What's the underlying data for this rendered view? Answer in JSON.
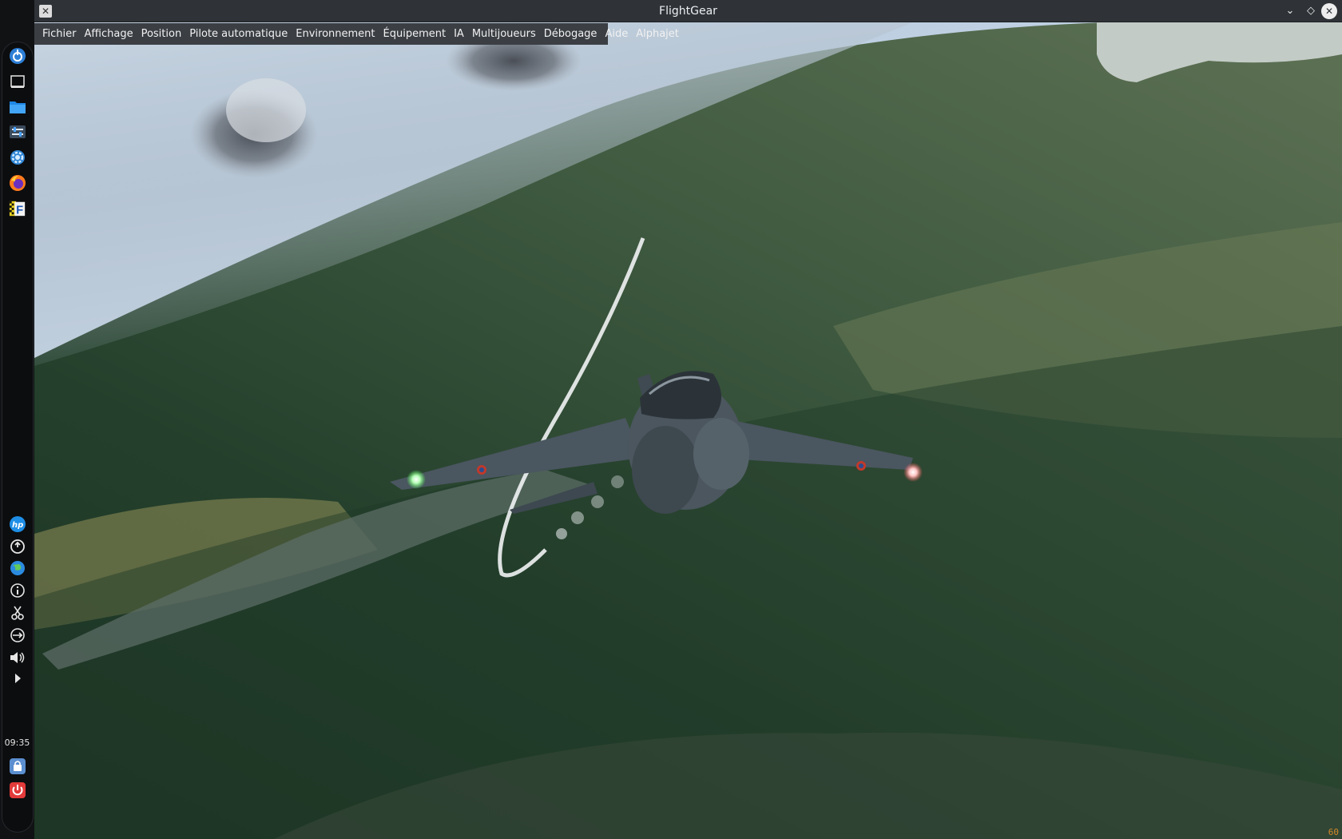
{
  "window": {
    "title": "FlightGear",
    "app_icon": "x-icon",
    "controls": [
      "minimize-icon",
      "maximize-icon",
      "close-icon"
    ]
  },
  "menubar": {
    "items": [
      {
        "label": "Fichier"
      },
      {
        "label": "Affichage"
      },
      {
        "label": "Position"
      },
      {
        "label": "Pilote automatique"
      },
      {
        "label": "Environnement"
      },
      {
        "label": "Équipement"
      },
      {
        "label": "IA"
      },
      {
        "label": "Multijoueurs"
      },
      {
        "label": "Débogage"
      },
      {
        "label": "Aide"
      },
      {
        "label": "Alphajet"
      }
    ]
  },
  "dock": {
    "top_icons": [
      "launcher-icon",
      "desktop-icon",
      "file-manager-icon",
      "settings-sliders-icon",
      "gear-icon",
      "firefox-icon",
      "flightgear-icon"
    ],
    "tray_icons": [
      "hp-icon",
      "updates-icon",
      "network-globe-icon",
      "info-icon",
      "scissors-icon",
      "usb-icon",
      "volume-icon",
      "expand-arrow-icon"
    ],
    "clock": "09:35",
    "bottom_icons": [
      "lock-screen-icon",
      "power-icon"
    ]
  },
  "hud": {
    "fps": "60"
  },
  "colors": {
    "titlebar": "#2f3338",
    "menubar": "#3b3f44",
    "dock": "#101214",
    "fps_text": "#d2882b"
  }
}
